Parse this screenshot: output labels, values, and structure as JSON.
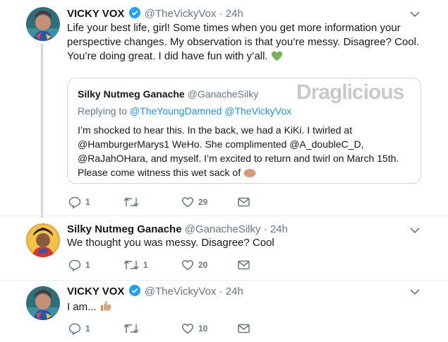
{
  "tweets": [
    {
      "name": "VICKY VOX",
      "handle": "@TheVickyVox",
      "separator": "·",
      "time": "24h",
      "verified": true,
      "lines": [
        "Life your best life, girl! Some times when you get more information your",
        "perspective changes. My observation is that you’re messy. Disagree? Cool.",
        "You’re doing great. I did have fun with y’all."
      ],
      "trailing_emoji": "green-heart",
      "quote": {
        "name": "Silky Nutmeg Ganache",
        "handle": "@GanacheSilky",
        "replying_prefix": "Replying to",
        "replying_to": "@TheYoungDamned @TheVickyVox",
        "lines": [
          "I’m shocked to hear this. In the back, we had a KiKi. I twirled at",
          "@HamburgerMarys1 WeHo. She complimented @A_doubleC_D,",
          "@RaJahOHara, and myself. I’m excited to return and twirl on March 15th.",
          "Please come witness this wet sack of"
        ],
        "trailing_emoji": "potato"
      },
      "actions": {
        "replies": "1",
        "retweets": "",
        "likes": "29"
      }
    },
    {
      "name": "Silky Nutmeg Ganache",
      "handle": "@GanacheSilky",
      "separator": "·",
      "time": "24h",
      "verified": false,
      "lines": [
        "We thought you was messy.  Disagree? Cool"
      ],
      "actions": {
        "replies": "1",
        "retweets": "1",
        "likes": "20"
      }
    },
    {
      "name": "VICKY VOX",
      "handle": "@TheVickyVox",
      "separator": "·",
      "time": "24h",
      "verified": true,
      "lines": [
        "I am..."
      ],
      "trailing_emoji": "thumbs-up",
      "actions": {
        "replies": "1",
        "retweets": "",
        "likes": "10"
      }
    }
  ],
  "watermark": "Draglicious",
  "colors": {
    "text": "#14171a",
    "secondary": "#657786",
    "link": "#1b95e0",
    "verified": "#1da1f2",
    "border": "#ccd6dd",
    "thread_line": "#ccd6dd",
    "heart_emoji": "#77b255"
  }
}
